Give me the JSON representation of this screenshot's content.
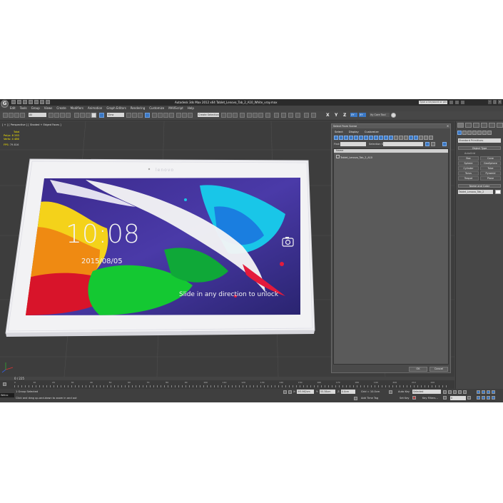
{
  "app": {
    "logo": "G",
    "title": "Autodesk 3ds Max 2012 x64     Tablet_Lenovo_Tab_2_A10_White_vray.max",
    "search_placeholder": "Type a keyword or phrase"
  },
  "menu": [
    "Edit",
    "Tools",
    "Group",
    "Views",
    "Create",
    "Modifiers",
    "Animation",
    "Graph Editors",
    "Rendering",
    "Customize",
    "MAXScript",
    "Help"
  ],
  "toolbar": {
    "selection_filter": "All",
    "view_dropdown": "View",
    "create_selection_set": "Create Selection",
    "axis_x": "X",
    "axis_y": "Y",
    "axis_z": "Z",
    "plane_xy": "XY",
    "plane_xy2": "XY",
    "curve_tool": "ity Care Tool"
  },
  "viewport": {
    "label": "[ + ] [ Perspective ] [ Shaded + Edged Faces ]",
    "stats": {
      "total_label": "Total",
      "polys_label": "Polys:",
      "polys_value": "8 283",
      "verts_label": "Verts:",
      "verts_value": "4 486",
      "fps_label": "FPS:",
      "fps_value": "79.816"
    },
    "screen": {
      "time": "10:08",
      "date": "2015/08/05",
      "unlock": "Slide in any direction to unlock",
      "brand": "lenovo"
    }
  },
  "dialog": {
    "title": "Select From Scene",
    "tabs": [
      "Select",
      "Display",
      "Customize"
    ],
    "find_label": "Find:",
    "selection_set_label": "Selection Set:",
    "column_name": "Name",
    "items": [
      "Tablet_Lenovo_Tab_2_A10"
    ],
    "ok": "OK",
    "cancel": "Cancel"
  },
  "command_panel": {
    "dropdown": "Standard Primitives",
    "object_type": "Object Type",
    "autogrid": "AutoGrid",
    "primitives": [
      "Box",
      "Cone",
      "Sphere",
      "GeoSphere",
      "Cylinder",
      "Tube",
      "Torus",
      "Pyramid",
      "Teapot",
      "Plane"
    ],
    "name_and_color": "Name and Color",
    "object_name": "Tablet_Lenovo_Tab_2"
  },
  "timeline": {
    "frame_counter": "0 / 225",
    "ticks": [
      "0",
      "10",
      "20",
      "30",
      "40",
      "50",
      "60",
      "70",
      "80",
      "90",
      "100",
      "110",
      "120",
      "130",
      "140",
      "150",
      "160",
      "170",
      "180",
      "190",
      "200",
      "210",
      "220"
    ]
  },
  "status": {
    "maxscript": "Welco",
    "selected": "1 Group Selected",
    "prompt": "Click and drag up-and-down to zoom in and out",
    "x_label": "X:",
    "x_value": "3f3.962cm",
    "y_label": "Y:",
    "y_value": "55.38cm",
    "z_label": "Z:",
    "z_value": "0.0cm",
    "grid": "Grid = 10.0cm",
    "auto_key": "Auto Key",
    "auto_key_value": "Selected",
    "set_key": "Set Key",
    "key_filters": "Key Filters...",
    "add_time_tag": "Add Time Tag",
    "frame": "0"
  },
  "colors": {
    "accent_blue": "#3b78c4",
    "stats_yellow": "#f5e600",
    "viewport_bg": "#3d3d3d"
  }
}
